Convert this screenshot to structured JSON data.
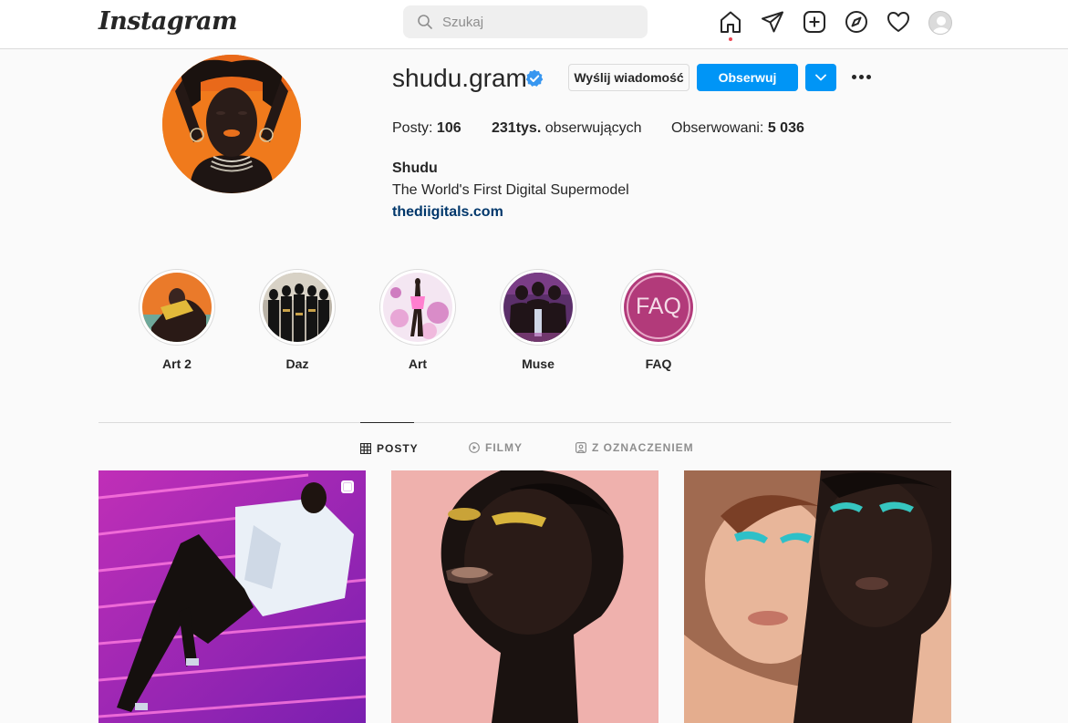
{
  "nav": {
    "logo": "Instagram",
    "search_placeholder": "Szukaj",
    "icons": [
      "home-icon",
      "direct-icon",
      "new-post-icon",
      "explore-icon",
      "activity-icon",
      "avatar"
    ]
  },
  "profile": {
    "username": "shudu.gram",
    "verified": true,
    "message_button": "Wyślij wiadomość",
    "follow_button": "Obserwuj",
    "posts_label": "Posty:",
    "posts_count": "106",
    "followers_count": "231tys.",
    "followers_label": "obserwujących",
    "following_label": "Obserwowani:",
    "following_count": "5 036",
    "full_name": "Shudu",
    "bio": "The World's First Digital Supermodel",
    "website": "thediigitals.com"
  },
  "highlights": [
    {
      "label": "Art 2"
    },
    {
      "label": "Daz"
    },
    {
      "label": "Art"
    },
    {
      "label": "Muse"
    },
    {
      "label": "FAQ",
      "cover_text": "FAQ"
    }
  ],
  "tabs": [
    {
      "label": "POSTY",
      "icon": "grid-icon",
      "active": true
    },
    {
      "label": "FILMY",
      "icon": "play-icon",
      "active": false
    },
    {
      "label": "Z OZNACZENIEM",
      "icon": "tagged-icon",
      "active": false
    }
  ],
  "colors": {
    "accent": "#0095f6",
    "verified": "#3897f0",
    "link": "#00376b",
    "notification": "#ed4956"
  }
}
